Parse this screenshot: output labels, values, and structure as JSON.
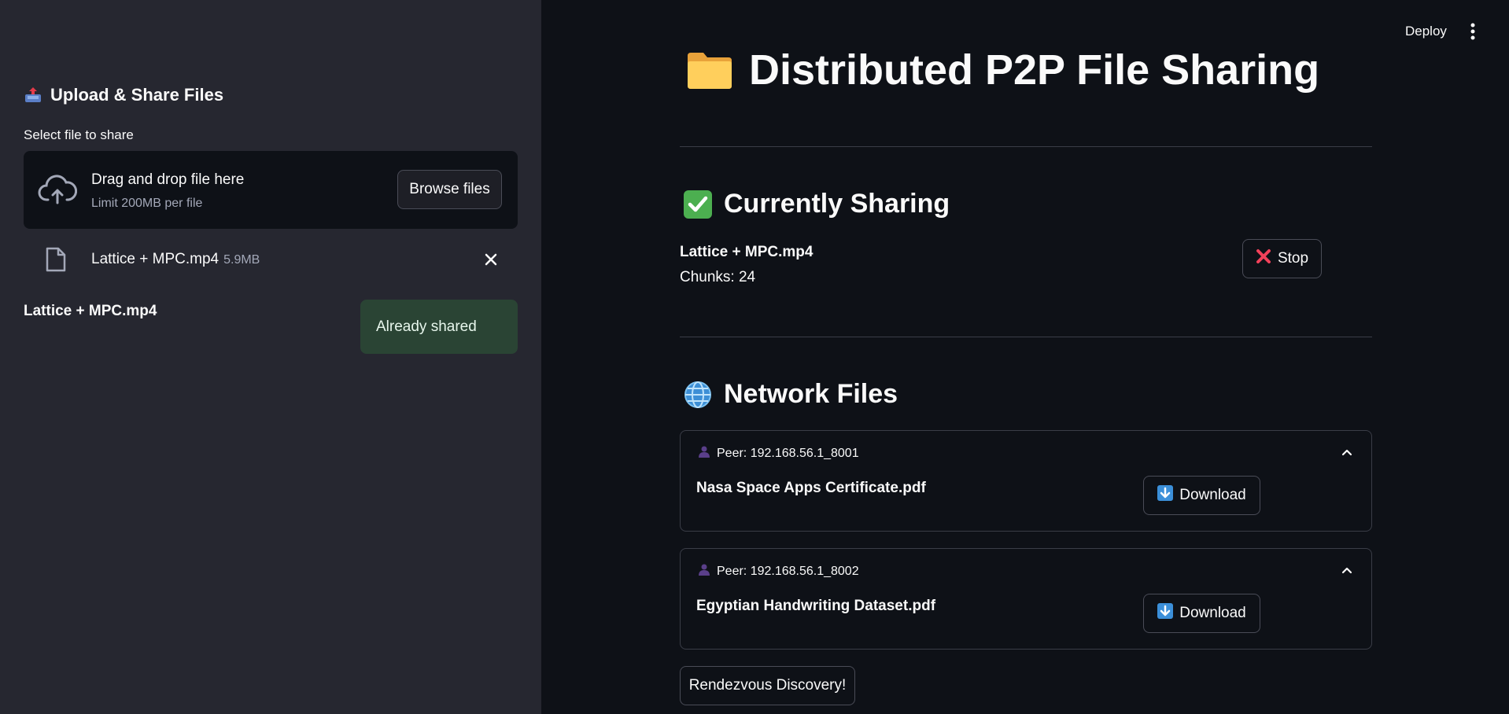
{
  "sidebar": {
    "title": "Upload & Share Files",
    "select_label": "Select file to share",
    "dropzone": {
      "text": "Drag and drop file here",
      "limit": "Limit 200MB per file",
      "browse_label": "Browse files"
    },
    "uploaded_file": {
      "name": "Lattice + MPC.mp4",
      "size": "5.9MB"
    },
    "shared_file_name": "Lattice + MPC.mp4",
    "alert": "Already shared"
  },
  "topbar": {
    "deploy": "Deploy"
  },
  "main": {
    "title": "Distributed P2P File Sharing",
    "currently_sharing": {
      "heading": "Currently Sharing",
      "file_name": "Lattice + MPC.mp4",
      "chunks": "Chunks: 24",
      "stop_label": "Stop"
    },
    "network_files": {
      "heading": "Network Files",
      "peers": [
        {
          "peer": "Peer: 192.168.56.1_8001",
          "file": "Nasa Space Apps Certificate.pdf",
          "download_label": "Download"
        },
        {
          "peer": "Peer: 192.168.56.1_8002",
          "file": "Egyptian Handwriting Dataset.pdf",
          "download_label": "Download"
        }
      ]
    },
    "rendezvous_label": "Rendezvous Discovery!"
  },
  "colors": {
    "background": "#0e1117",
    "sidebar": "#262730",
    "success_alert": "#2a4434",
    "border": "#3a3d47"
  }
}
